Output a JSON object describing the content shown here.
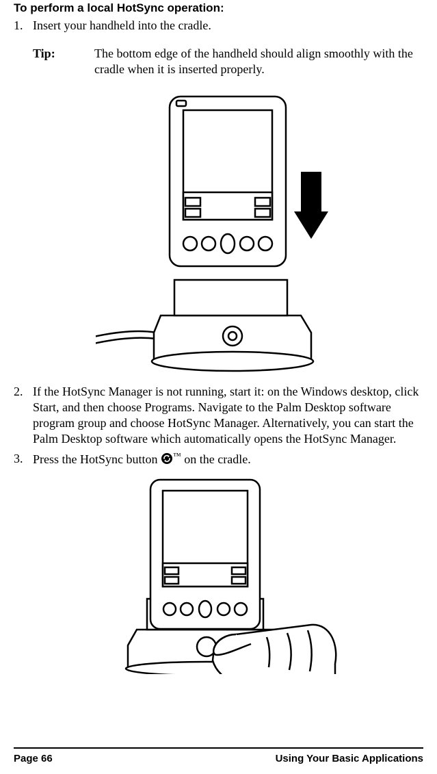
{
  "heading": "To perform a local HotSync operation:",
  "steps": [
    {
      "num": "1.",
      "text": "Insert your handheld into the cradle."
    },
    {
      "num": "2.",
      "text": "If the HotSync Manager is not running, start it: on the Windows desktop, click Start, and then choose Programs. Navigate to the Palm Desktop software program group and choose HotSync Manager. Alternatively, you can start the Palm Desktop software which automatically opens the HotSync Manager."
    },
    {
      "num": "3.",
      "text_a": "Press the HotSync button ",
      "text_b": " on the cradle."
    }
  ],
  "tip": {
    "label": "Tip:",
    "text": "The bottom edge of the handheld should align smoothly with the cradle when it is inserted properly."
  },
  "hotsync_tm": "™",
  "footer": {
    "left": "Page 66",
    "right": "Using Your Basic Applications"
  }
}
